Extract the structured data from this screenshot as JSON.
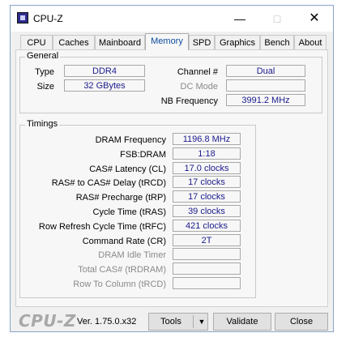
{
  "window": {
    "title": "CPU-Z"
  },
  "tabs": [
    "CPU",
    "Caches",
    "Mainboard",
    "Memory",
    "SPD",
    "Graphics",
    "Bench",
    "About"
  ],
  "active_tab": "Memory",
  "general": {
    "title": "General",
    "type_label": "Type",
    "type_value": "DDR4",
    "size_label": "Size",
    "size_value": "32 GBytes",
    "channel_label": "Channel #",
    "channel_value": "Dual",
    "dcmode_label": "DC Mode",
    "dcmode_value": "",
    "nbfreq_label": "NB Frequency",
    "nbfreq_value": "3991.2 MHz"
  },
  "timings": {
    "title": "Timings",
    "rows": [
      {
        "label": "DRAM Frequency",
        "value": "1196.8 MHz",
        "enabled": true
      },
      {
        "label": "FSB:DRAM",
        "value": "1:18",
        "enabled": true
      },
      {
        "label": "CAS# Latency (CL)",
        "value": "17.0 clocks",
        "enabled": true
      },
      {
        "label": "RAS# to CAS# Delay (tRCD)",
        "value": "17 clocks",
        "enabled": true
      },
      {
        "label": "RAS# Precharge (tRP)",
        "value": "17 clocks",
        "enabled": true
      },
      {
        "label": "Cycle Time (tRAS)",
        "value": "39 clocks",
        "enabled": true
      },
      {
        "label": "Row Refresh Cycle Time (tRFC)",
        "value": "421 clocks",
        "enabled": true
      },
      {
        "label": "Command Rate (CR)",
        "value": "2T",
        "enabled": true
      },
      {
        "label": "DRAM Idle Timer",
        "value": "",
        "enabled": false
      },
      {
        "label": "Total CAS# (tRDRAM)",
        "value": "",
        "enabled": false
      },
      {
        "label": "Row To Column (tRCD)",
        "value": "",
        "enabled": false
      }
    ]
  },
  "footer": {
    "brand": "CPU-Z",
    "version": "Ver. 1.75.0.x32",
    "tools_label": "Tools",
    "validate_label": "Validate",
    "close_label": "Close"
  },
  "colors": {
    "value_text": "#1a1a8c",
    "active_tab_text": "#0b4a9e"
  }
}
